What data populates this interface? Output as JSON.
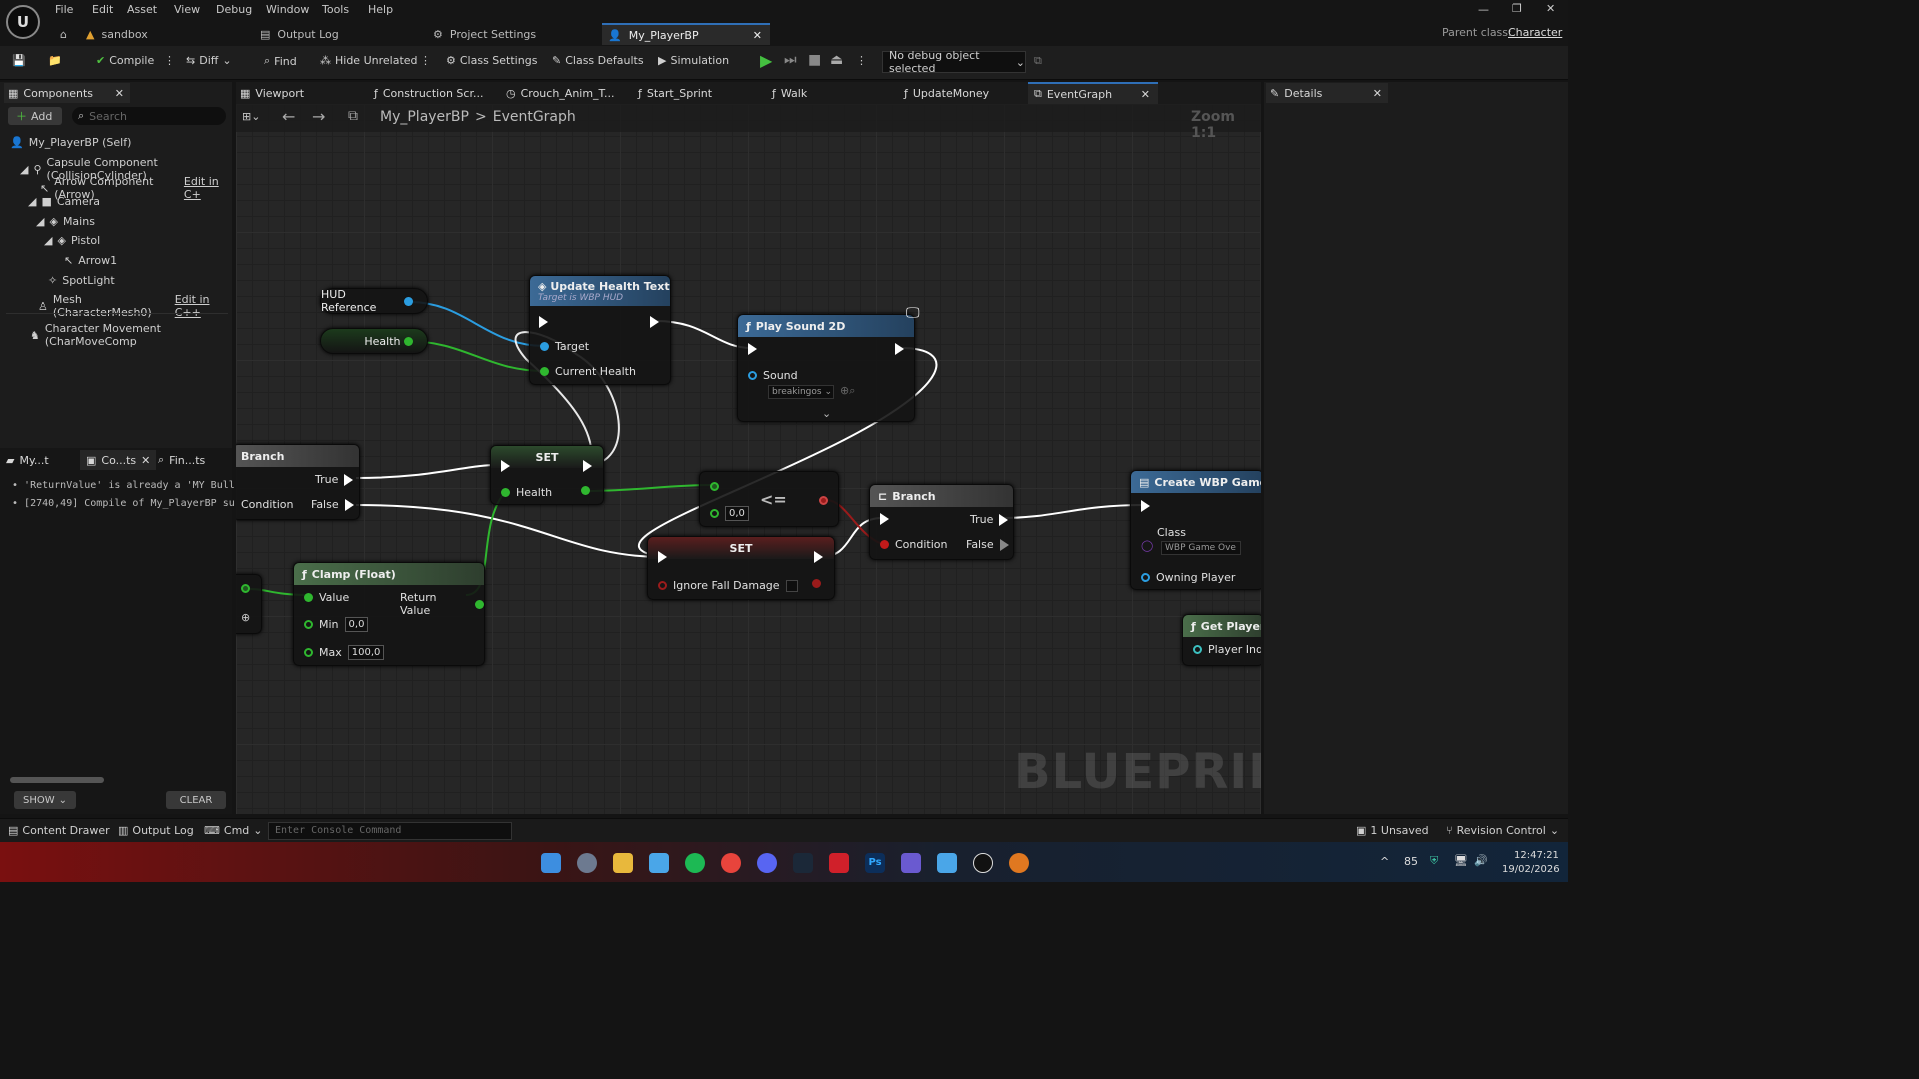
{
  "menu": [
    "File",
    "Edit",
    "Asset",
    "View",
    "Debug",
    "Window",
    "Tools",
    "Help"
  ],
  "tabs": [
    {
      "label": "sandbox"
    },
    {
      "label": "Output Log"
    },
    {
      "label": "Project Settings"
    },
    {
      "label": "My_PlayerBP"
    }
  ],
  "parent_class": {
    "label": "Parent class:",
    "value": "Character"
  },
  "toolbar": {
    "compile": "Compile",
    "diff": "Diff",
    "find": "Find",
    "hide_unrelated": "Hide Unrelated",
    "class_settings": "Class Settings",
    "class_defaults": "Class Defaults",
    "simulation": "Simulation",
    "debug_object": "No debug object selected"
  },
  "components_panel": {
    "title": "Components",
    "add": "Add",
    "search_placeholder": "Search",
    "items": [
      {
        "label": "My_PlayerBP (Self)"
      },
      {
        "label": "Capsule Component (CollisionCylinder)"
      },
      {
        "label": "Arrow Component (Arrow)",
        "link": "Edit in C+"
      },
      {
        "label": "Camera"
      },
      {
        "label": "Mains"
      },
      {
        "label": "Pistol"
      },
      {
        "label": "Arrow1"
      },
      {
        "label": "SpotLight"
      },
      {
        "label": "Mesh (CharacterMesh0)",
        "link": "Edit in C++"
      },
      {
        "label": "Character Movement (CharMoveComp"
      }
    ]
  },
  "graph_tabs": [
    "Viewport",
    "Construction Scr...",
    "Crouch_Anim_T...",
    "Start_Sprint",
    "Walk",
    "UpdateMoney",
    "EventGraph"
  ],
  "breadcrumb": {
    "bp": "My_PlayerBP",
    "sep": ">",
    "graph": "EventGraph",
    "zoom": "Zoom 1:1"
  },
  "watermark": "BLUEPRINT",
  "lower_tabs": [
    "My...t",
    "Co...ts",
    "Fin...ts"
  ],
  "log_lines": [
    "'ReturnValue' is already a 'MY Bull",
    "[2740,49] Compile of My_PlayerBP su"
  ],
  "log_buttons": {
    "show": "SHOW",
    "clear": "CLEAR"
  },
  "details": {
    "title": "Details"
  },
  "nodes": {
    "hud_ref": "HUD Reference",
    "health_var": "Health",
    "update_health": {
      "title": "Update Health Text",
      "subtitle": "Target is WBP HUD",
      "target": "Target",
      "current_health": "Current Health"
    },
    "play_sound": {
      "title": "Play Sound 2D",
      "sound": "Sound",
      "sound_value": "breakingos"
    },
    "branch1": {
      "title": "Branch",
      "true": "True",
      "false": "False",
      "condition": "Condition"
    },
    "set_health": {
      "title": "SET",
      "pin": "Health"
    },
    "compare": {
      "op": "<=",
      "value": "0,0"
    },
    "set_ignore": {
      "title": "SET",
      "pin": "Ignore Fall Damage"
    },
    "branch2": {
      "title": "Branch",
      "condition": "Condition",
      "true": "True",
      "false": "False"
    },
    "create_widget": {
      "title": "Create WBP Game Ove",
      "class": "Class",
      "class_value": "WBP Game Ove",
      "owning": "Owning Player"
    },
    "clamp": {
      "title": "Clamp (Float)",
      "value": "Value",
      "return": "Return Value",
      "min": "Min",
      "min_value": "0,0",
      "max": "Max",
      "max_value": "100,0"
    },
    "get_player": {
      "title": "Get Player",
      "pin": "Player Inde"
    }
  },
  "statusbar": {
    "content_drawer": "Content Drawer",
    "output_log": "Output Log",
    "cmd": "Cmd",
    "console_placeholder": "Enter Console Command",
    "unsaved": "1 Unsaved",
    "revision": "Revision Control"
  },
  "taskbar": {
    "temp": "85",
    "time": "12:47:21",
    "date": "19/02/2026"
  }
}
